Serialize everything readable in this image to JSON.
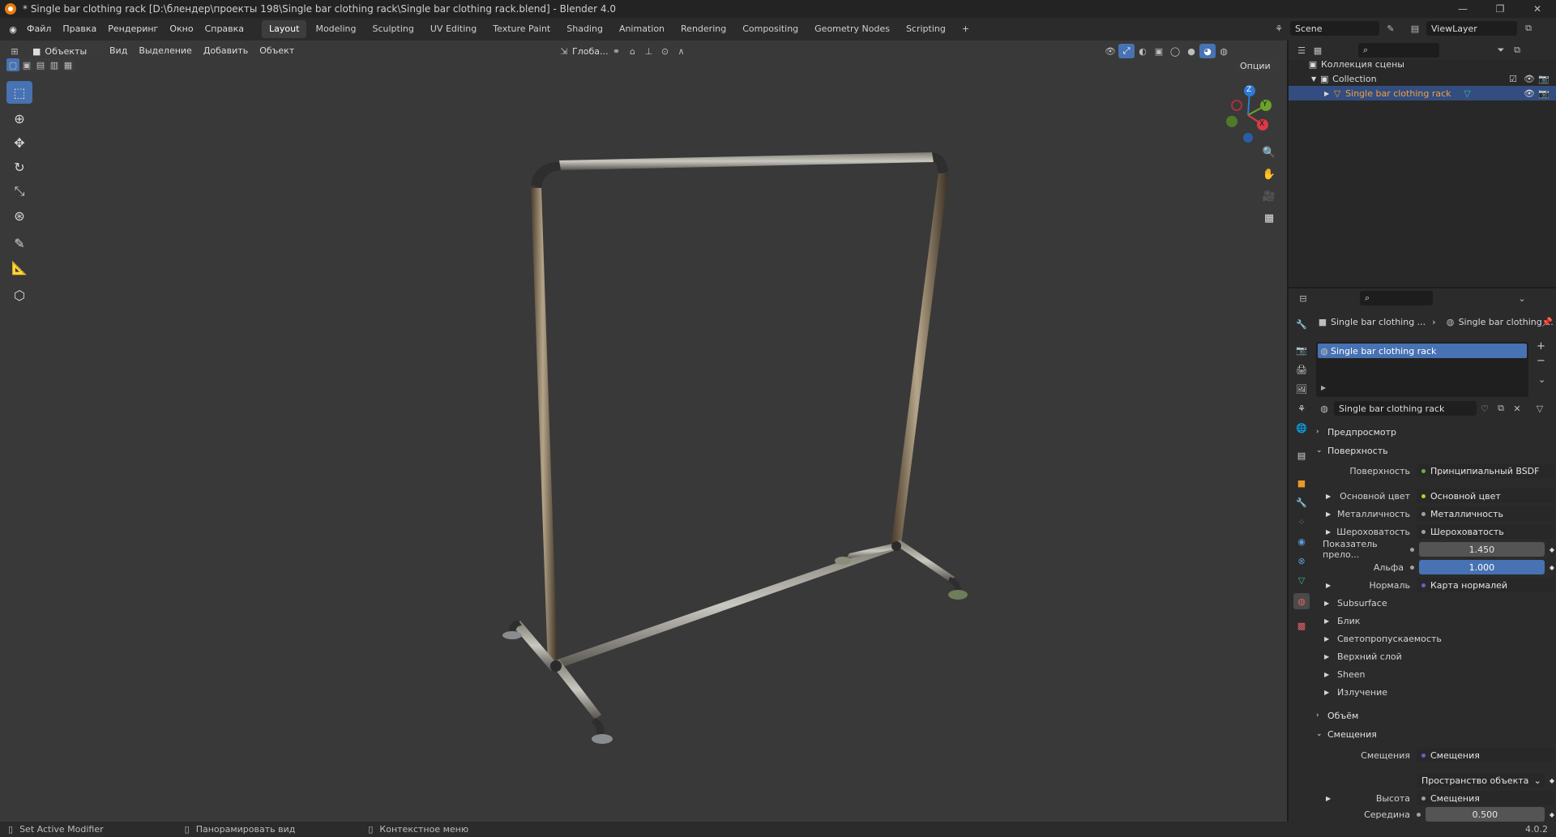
{
  "titlebar": {
    "title": "* Single bar clothing rack [D:\\блендер\\проекты 198\\Single bar clothing rack\\Single bar clothing rack.blend] - Blender 4.0",
    "minimize": "—",
    "maximize": "❐",
    "close": "✕"
  },
  "menu": {
    "items": [
      "Файл",
      "Правка",
      "Рендеринг",
      "Окно",
      "Справка"
    ]
  },
  "workspaces": {
    "tabs": [
      "Layout",
      "Modeling",
      "Sculpting",
      "UV Editing",
      "Texture Paint",
      "Shading",
      "Animation",
      "Rendering",
      "Compositing",
      "Geometry Nodes",
      "Scripting"
    ],
    "active": "Layout",
    "add": "+"
  },
  "scene": {
    "name": "Scene",
    "view_layer": "ViewLayer"
  },
  "viewport_header": {
    "mode": "Объекты",
    "menus": [
      "Вид",
      "Выделение",
      "Добавить",
      "Объект"
    ],
    "orientation": "Глоба...",
    "options": "Опции"
  },
  "gizmo": {
    "z": "Z",
    "y": "Y",
    "x": "X"
  },
  "outliner": {
    "scene_collection": "Коллекция сцены",
    "collection": "Collection",
    "object": "Single bar clothing rack"
  },
  "properties": {
    "breadcrumb_object": "Single bar clothing ...",
    "breadcrumb_material": "Single bar clothing ...",
    "material_slot": "Single bar clothing rack",
    "material_name": "Single bar clothing rack",
    "panels": {
      "preview": "Предпросмотр",
      "surface": "Поверхность",
      "volume": "Объём",
      "displacement": "Смещения"
    },
    "surface_rows": [
      {
        "label": "Поверхность",
        "value": "Принципиальный BSDF",
        "dot": "#6ab04c"
      },
      {
        "label": "Основной цвет",
        "value": "Основной цвет",
        "dot": "#c7c729"
      },
      {
        "label": "Металличность",
        "value": "Металличность",
        "dot": "#a1a1a1"
      },
      {
        "label": "Шероховатость",
        "value": "Шероховатость",
        "dot": "#a1a1a1"
      },
      {
        "label": "Показатель прело...",
        "value": "1.450",
        "dot": "#a1a1a1"
      },
      {
        "label": "Альфа",
        "value": "1.000",
        "dot": "#a1a1a1"
      },
      {
        "label": "Нормаль",
        "value": "Карта нормалей",
        "dot": "#6363c7"
      }
    ],
    "subpanels": [
      "Subsurface",
      "Блик",
      "Светопропускаемость",
      "Верхний слой",
      "Sheen",
      "Излучение"
    ],
    "displacement_rows": [
      {
        "label": "Смещения",
        "value": "Смещения",
        "dot": "#6363c7"
      },
      {
        "label": "",
        "value": "Пространство объекта",
        "dot": ""
      },
      {
        "label": "Высота",
        "value": "Смещения",
        "dot": "#a1a1a1"
      },
      {
        "label": "Середина",
        "value": "0.500",
        "dot": "#a1a1a1"
      }
    ]
  },
  "statusbar": {
    "item1": "Set Active Modifier",
    "item2": "Панорамировать вид",
    "item3": "Контекстное меню",
    "version": "4.0.2"
  }
}
